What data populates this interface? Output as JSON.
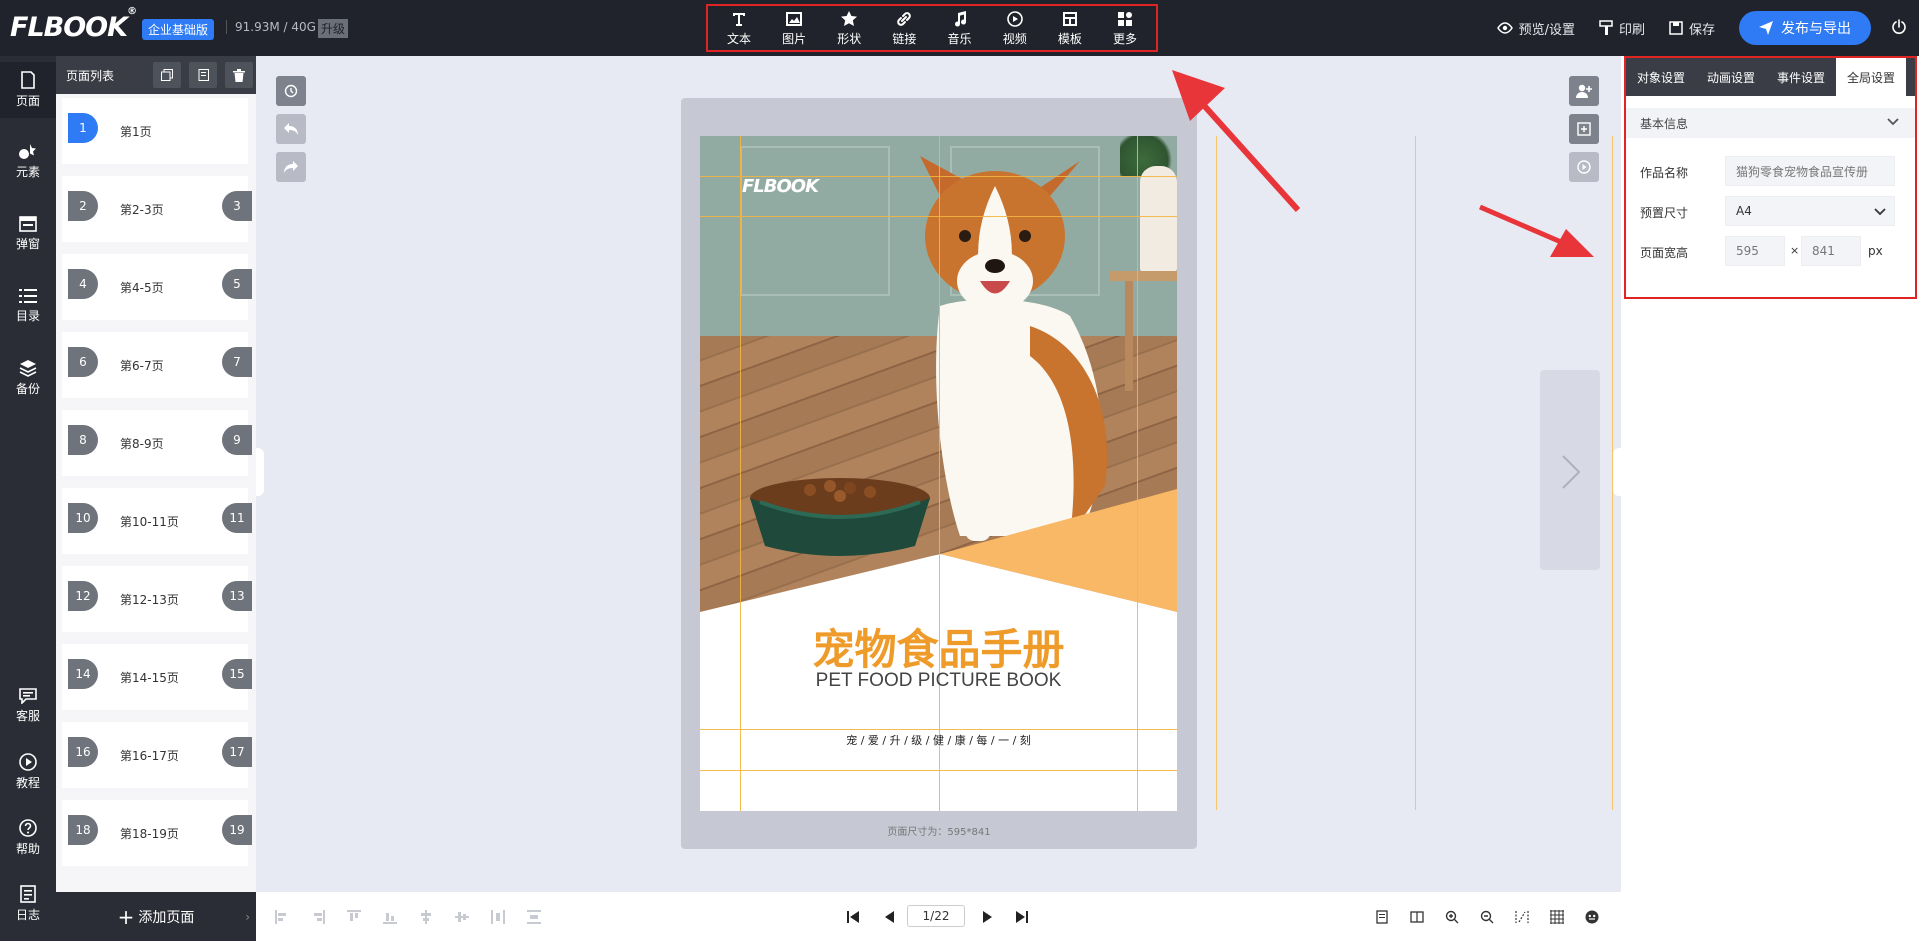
{
  "topbar": {
    "logo_text": "FLBOOK",
    "logo_mark": "®",
    "edition": "企业基础版",
    "storage": "91.93M / 40G",
    "upgrade": "升级",
    "tools": [
      {
        "label": "文本",
        "icon": "text-icon"
      },
      {
        "label": "图片",
        "icon": "image-icon"
      },
      {
        "label": "形状",
        "icon": "star-icon"
      },
      {
        "label": "链接",
        "icon": "link-icon"
      },
      {
        "label": "音乐",
        "icon": "music-icon"
      },
      {
        "label": "视频",
        "icon": "play-icon"
      },
      {
        "label": "模板",
        "icon": "template-icon"
      },
      {
        "label": "更多",
        "icon": "more-icon"
      }
    ],
    "preview": "预览/设置",
    "print": "印刷",
    "save": "保存",
    "publish": "发布与导出"
  },
  "leftnav": [
    {
      "label": "页面",
      "icon": "page-icon"
    },
    {
      "label": "元素",
      "icon": "elements-icon"
    },
    {
      "label": "弹窗",
      "icon": "popup-icon"
    },
    {
      "label": "目录",
      "icon": "toc-icon"
    },
    {
      "label": "备份",
      "icon": "layers-icon"
    },
    {
      "label": "客服",
      "icon": "service-icon"
    },
    {
      "label": "教程",
      "icon": "tutorial-icon"
    },
    {
      "label": "帮助",
      "icon": "help-icon"
    },
    {
      "label": "日志",
      "icon": "log-icon"
    }
  ],
  "pagelist": {
    "title": "页面列表",
    "items": [
      {
        "left": "1",
        "label": "第1页",
        "right": ""
      },
      {
        "left": "2",
        "label": "第2-3页",
        "right": "3"
      },
      {
        "left": "4",
        "label": "第4-5页",
        "right": "5"
      },
      {
        "left": "6",
        "label": "第6-7页",
        "right": "7"
      },
      {
        "left": "8",
        "label": "第8-9页",
        "right": "9"
      },
      {
        "left": "10",
        "label": "第10-11页",
        "right": "11"
      },
      {
        "left": "12",
        "label": "第12-13页",
        "right": "13"
      },
      {
        "left": "14",
        "label": "第14-15页",
        "right": "15"
      },
      {
        "left": "16",
        "label": "第16-17页",
        "right": "17"
      },
      {
        "left": "18",
        "label": "第18-19页",
        "right": "19"
      }
    ],
    "add_page": "添加页面"
  },
  "canvas": {
    "cover_logo": "FLBOOK",
    "title": "宠物食品手册",
    "subtitle": "PET FOOD PICTURE BOOK",
    "tagline": "宠 / 爱 / 升 / 级 / 健 / 康 / 每 / 一 / 刻",
    "size_note": "页面尺寸为：595*841"
  },
  "rightpanel": {
    "tabs": [
      "对象设置",
      "动画设置",
      "事件设置",
      "全局设置"
    ],
    "section": "基本信息",
    "name_label": "作品名称",
    "name_value": "猫狗零食宠物食品宣传册",
    "preset_label": "预置尺寸",
    "preset_value": "A4",
    "size_label": "页面宽高",
    "width": "595",
    "times": "×",
    "height": "841",
    "unit": "px"
  },
  "bottombar": {
    "page_indicator": "1/22"
  },
  "colors": {
    "accent": "#2f7bf5",
    "highlight": "#e02424",
    "title_orange": "#ee9b2a",
    "topbar_bg": "#20232b"
  }
}
